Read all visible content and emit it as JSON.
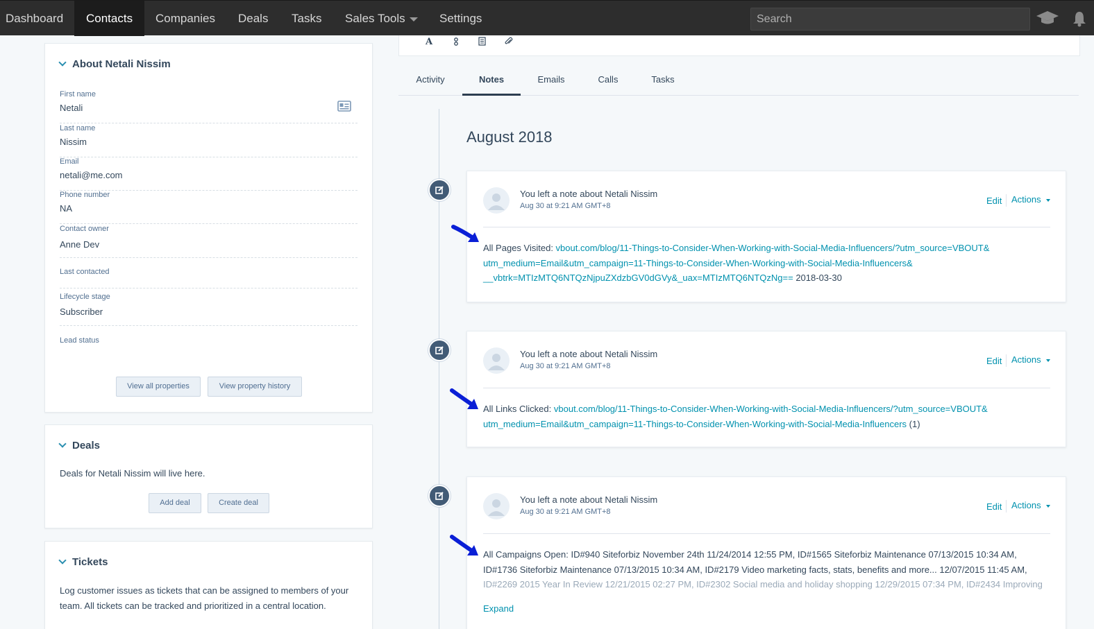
{
  "nav": {
    "items": [
      "Dashboard",
      "Contacts",
      "Companies",
      "Deals",
      "Tasks",
      "Sales Tools",
      "Settings"
    ],
    "active": "Contacts",
    "search_placeholder": "Search",
    "icons": [
      "academy-icon",
      "notifications-icon"
    ]
  },
  "about": {
    "title": "About Netali Nissim",
    "fields": [
      {
        "label": "First name",
        "value": "Netali"
      },
      {
        "label": "Last name",
        "value": "Nissim"
      },
      {
        "label": "Email",
        "value": "netali@me.com"
      },
      {
        "label": "Phone number",
        "value": "NA"
      },
      {
        "label": "Contact owner",
        "value": "Anne Dev"
      },
      {
        "label": "Last contacted",
        "value": ""
      },
      {
        "label": "Lifecycle stage",
        "value": "Subscriber"
      },
      {
        "label": "Lead status",
        "value": ""
      }
    ],
    "view_all_label": "View all properties",
    "history_label": "View property history"
  },
  "deals": {
    "title": "Deals",
    "text_prefix": "Deals for ",
    "name": "Netali Nissim",
    "text_suffix": " will live here.",
    "add_label": "Add deal",
    "create_label": "Create deal"
  },
  "tickets": {
    "title": "Tickets",
    "text": "Log customer issues as tickets that can be assigned to members of your team. All tickets can be tracked and prioritized in a central location."
  },
  "tabs": [
    "Activity",
    "Notes",
    "Emails",
    "Calls",
    "Tasks"
  ],
  "active_tab": "Notes",
  "timeline": {
    "month": "August 2018",
    "notes": [
      {
        "author_text": "You left a note about ",
        "contact": "Netali Nissim",
        "date": "Aug 30 at 9:21 AM GMT+8",
        "edit_label": "Edit",
        "actions_label": "Actions",
        "label": "All Pages Visited: ",
        "link_lines": [
          "vbout.com/blog/11-Things-to-Consider-When-Working-with-Social-Media-Influencers/?utm_source=VBOUT&",
          "utm_medium=Email&utm_campaign=11-Things-to-Consider-When-Working-with-Social-Media-Influencers&",
          "__vbtrk=MTIzMTQ6NTQzNjpuZXdzbGV0dGVy&_uax=MTIzMTQ6NTQzNg=="
        ],
        "suffix": " 2018-03-30"
      },
      {
        "author_text": "You left a note about ",
        "contact": "Netali Nissim",
        "date": "Aug 30 at 9:21 AM GMT+8",
        "edit_label": "Edit",
        "actions_label": "Actions",
        "label": "All Links Clicked: ",
        "link_lines": [
          "vbout.com/blog/11-Things-to-Consider-When-Working-with-Social-Media-Influencers/?utm_source=VBOUT&",
          "utm_medium=Email&utm_campaign=11-Things-to-Consider-When-Working-with-Social-Media-Influencers"
        ],
        "suffix": " (1)"
      },
      {
        "author_text": "You left a note about ",
        "contact": "Netali Nissim",
        "date": "Aug 30 at 9:21 AM GMT+8",
        "edit_label": "Edit",
        "actions_label": "Actions",
        "lines": [
          "All Campaigns Open: ID#940 Siteforbiz November 24th 11/24/2014 12:55 PM, ID#1565 Siteforbiz Maintenance 07/13/2015 10:34 AM,",
          "ID#1736 Siteforbiz Maintenance 07/13/2015 10:34 AM, ID#2179 Video marketing facts, stats, benefits and more... 12/07/2015 11:45 AM,",
          "ID#2269 2015 Year In Review 12/21/2015 02:27 PM, ID#2302 Social media and holiday shopping 12/29/2015 07:34 PM, ID#2434 Improving"
        ],
        "expand_label": "Expand"
      }
    ]
  },
  "colors": {
    "nav_bg": "#2d2d2d",
    "link": "#0091ae",
    "text": "#33475b",
    "timeline_dot": "#425b76",
    "annotation_arrow": "#0a1fd6"
  }
}
